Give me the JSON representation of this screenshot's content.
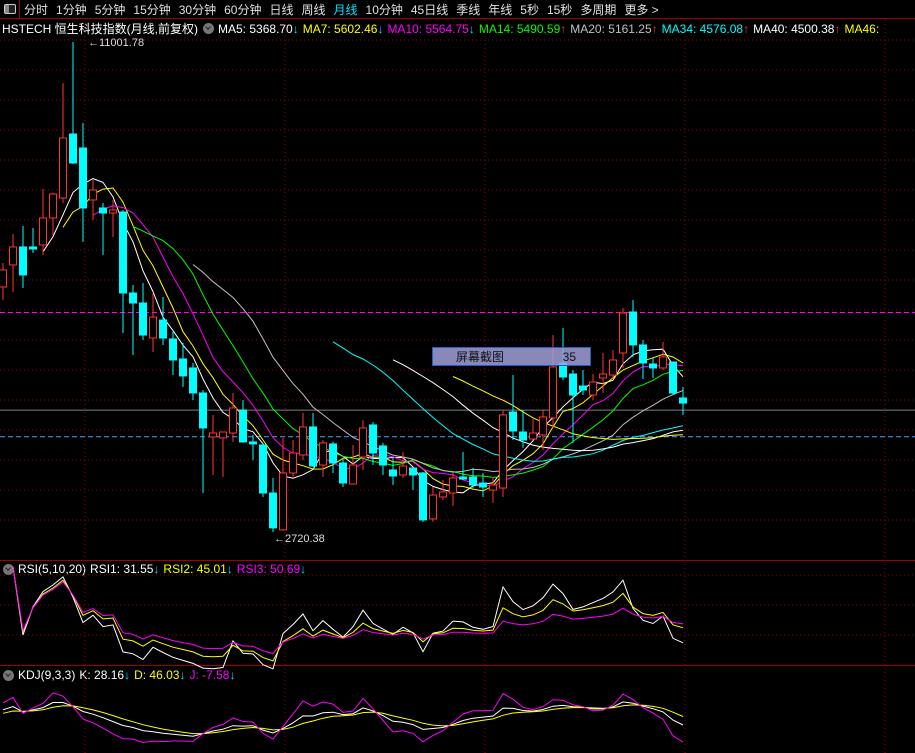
{
  "menu": {
    "items": [
      "分时",
      "1分钟",
      "5分钟",
      "15分钟",
      "30分钟",
      "60分钟",
      "日线",
      "周线",
      "月线",
      "10分钟",
      "45日线",
      "季线",
      "年线",
      "5秒",
      "15秒",
      "多周期",
      "更多 >"
    ],
    "active": "月线"
  },
  "header": {
    "title": "HSTECH 恒生科技指数(月线,前复权)",
    "ma": [
      {
        "label": "MA5: 5368.70",
        "dir": "down",
        "color": "#ffffff"
      },
      {
        "label": "MA7: 5602.46",
        "dir": "down",
        "color": "#ffff00"
      },
      {
        "label": "MA10: 5564.75",
        "dir": "down",
        "color": "#ff00ff"
      },
      {
        "label": "MA14: 5490.59",
        "dir": "up",
        "color": "#00ff00"
      },
      {
        "label": "MA20: 5161.25",
        "dir": "up",
        "color": "#c0c0c0"
      },
      {
        "label": "MA34: 4576.08",
        "dir": "up",
        "color": "#00ffff"
      },
      {
        "label": "MA40: 4500.38",
        "dir": "up",
        "color": "#ffffff"
      },
      {
        "label": "MA46:",
        "dir": "none",
        "color": "#ffff00"
      }
    ]
  },
  "rsi_header": {
    "title": "RSI(5,10,20)",
    "items": [
      {
        "label": "RSI1: 31.55",
        "dir": "down",
        "color": "#ffffff"
      },
      {
        "label": "RSI2: 45.01",
        "dir": "down",
        "color": "#ffff00"
      },
      {
        "label": "RSI3: 50.69",
        "dir": "down",
        "color": "#ff00ff"
      }
    ]
  },
  "kdj_header": {
    "title": "KDJ(9,3,3)",
    "items": [
      {
        "label": "K: 28.16",
        "dir": "down",
        "color": "#ffffff"
      },
      {
        "label": "D: 46.03",
        "dir": "down",
        "color": "#ffff00"
      },
      {
        "label": "J: -7.58",
        "dir": "down",
        "color": "#ff00ff"
      }
    ]
  },
  "overlay": {
    "label": "屏幕截图",
    "value": "35"
  },
  "colors": {
    "up": "#ff3232",
    "down": "#00ffff",
    "grid": "#a00000"
  },
  "chart_data": {
    "type": "candlestick",
    "title": "HSTECH 恒生科技指数(月线,前复权)",
    "annotations": {
      "high": "11001.78",
      "low": "2720.38"
    },
    "high_value": 11001.78,
    "low_value": 2720.38,
    "ma_periods": [
      5,
      7,
      10,
      14,
      20,
      34,
      40,
      46
    ],
    "ma_colors": [
      "#ffffff",
      "#ffff00",
      "#ff00ff",
      "#00ff00",
      "#c0c0c0",
      "#00ffff",
      "#ffffff",
      "#ffff00"
    ],
    "ohlc": [
      [
        6862,
        7267,
        6642,
        7149
      ],
      [
        7234,
        7757,
        6777,
        7538
      ],
      [
        7538,
        7893,
        6845,
        7065
      ],
      [
        7538,
        7859,
        7436,
        7504
      ],
      [
        7572,
        8518,
        7403,
        8028
      ],
      [
        8028,
        8450,
        7741,
        8433
      ],
      [
        8366,
        10309,
        8281,
        9380
      ],
      [
        9447,
        11002,
        8940,
        8957
      ],
      [
        9211,
        9633,
        7622,
        8197
      ],
      [
        8332,
        8670,
        7994,
        8501
      ],
      [
        8197,
        8281,
        7403,
        8112
      ],
      [
        8112,
        8332,
        7707,
        8163
      ],
      [
        8129,
        8163,
        6084,
        6760
      ],
      [
        6760,
        6896,
        5712,
        6591
      ],
      [
        6591,
        6929,
        5966,
        6050
      ],
      [
        5999,
        6760,
        5763,
        6354
      ],
      [
        6303,
        6692,
        5882,
        5999
      ],
      [
        5983,
        6135,
        5374,
        5628
      ],
      [
        5645,
        5915,
        5171,
        5358
      ],
      [
        5493,
        5577,
        4952,
        5070
      ],
      [
        5070,
        5121,
        3380,
        4479
      ],
      [
        4327,
        4699,
        3684,
        4394
      ],
      [
        4310,
        4411,
        3650,
        4411
      ],
      [
        4394,
        5070,
        4243,
        4817
      ],
      [
        4783,
        4952,
        4226,
        4243
      ],
      [
        4243,
        4361,
        3936,
        4209
      ],
      [
        4192,
        4226,
        3313,
        3380
      ],
      [
        3380,
        3633,
        2720,
        2790
      ],
      [
        2756,
        4310,
        2740,
        3718
      ],
      [
        3718,
        4276,
        3650,
        4056
      ],
      [
        4022,
        4732,
        3936,
        4496
      ],
      [
        4496,
        4732,
        3819,
        3836
      ],
      [
        3853,
        4276,
        3650,
        4226
      ],
      [
        4209,
        4243,
        3718,
        3887
      ],
      [
        3887,
        3970,
        3481,
        3549
      ],
      [
        3532,
        4192,
        3532,
        3853
      ],
      [
        3988,
        4614,
        3769,
        4479
      ],
      [
        4530,
        4580,
        3853,
        4056
      ],
      [
        4175,
        4226,
        3684,
        3853
      ],
      [
        3769,
        3970,
        3515,
        3667
      ],
      [
        3684,
        4073,
        3633,
        3836
      ],
      [
        3802,
        3819,
        3430,
        3684
      ],
      [
        3718,
        3735,
        2891,
        2925
      ],
      [
        2942,
        3481,
        2891,
        3346
      ],
      [
        3313,
        3599,
        3262,
        3397
      ],
      [
        3380,
        3718,
        3161,
        3633
      ],
      [
        3650,
        4073,
        3600,
        3616
      ],
      [
        3650,
        3802,
        3464,
        3515
      ],
      [
        3549,
        3718,
        3313,
        3481
      ],
      [
        3430,
        3650,
        3212,
        3515
      ],
      [
        3464,
        4783,
        3313,
        4699
      ],
      [
        4749,
        5374,
        4276,
        4428
      ],
      [
        4411,
        4783,
        4142,
        4276
      ],
      [
        4293,
        4648,
        4276,
        4394
      ],
      [
        4361,
        4783,
        4107,
        4665
      ],
      [
        4648,
        6050,
        4479,
        5510
      ],
      [
        5577,
        6168,
        5290,
        5341
      ],
      [
        5391,
        5459,
        4226,
        5036
      ],
      [
        5188,
        5459,
        5036,
        5121
      ],
      [
        5036,
        5391,
        4952,
        5256
      ],
      [
        5324,
        5746,
        5070,
        5391
      ],
      [
        5374,
        5797,
        5307,
        5628
      ],
      [
        5746,
        6506,
        5493,
        6422
      ],
      [
        6439,
        6642,
        5679,
        5882
      ],
      [
        5882,
        5966,
        5307,
        5577
      ],
      [
        5560,
        5662,
        5324,
        5493
      ],
      [
        5493,
        5932,
        5459,
        5679
      ],
      [
        5594,
        5594,
        5036,
        5070
      ],
      [
        4986,
        5171,
        4699,
        4900
      ]
    ],
    "ohlc_order": [
      "open",
      "high",
      "low",
      "close"
    ],
    "reference_lines": [
      {
        "value": 6430,
        "style": "dashed",
        "color": "#ff00ff"
      },
      {
        "value": 4780,
        "style": "solid",
        "color": "#808080"
      },
      {
        "value": 4330,
        "style": "dashed",
        "color": "#4aa0ff"
      }
    ],
    "indicators": [
      "RSI(5,10,20)",
      "KDJ(9,3,3)"
    ]
  }
}
